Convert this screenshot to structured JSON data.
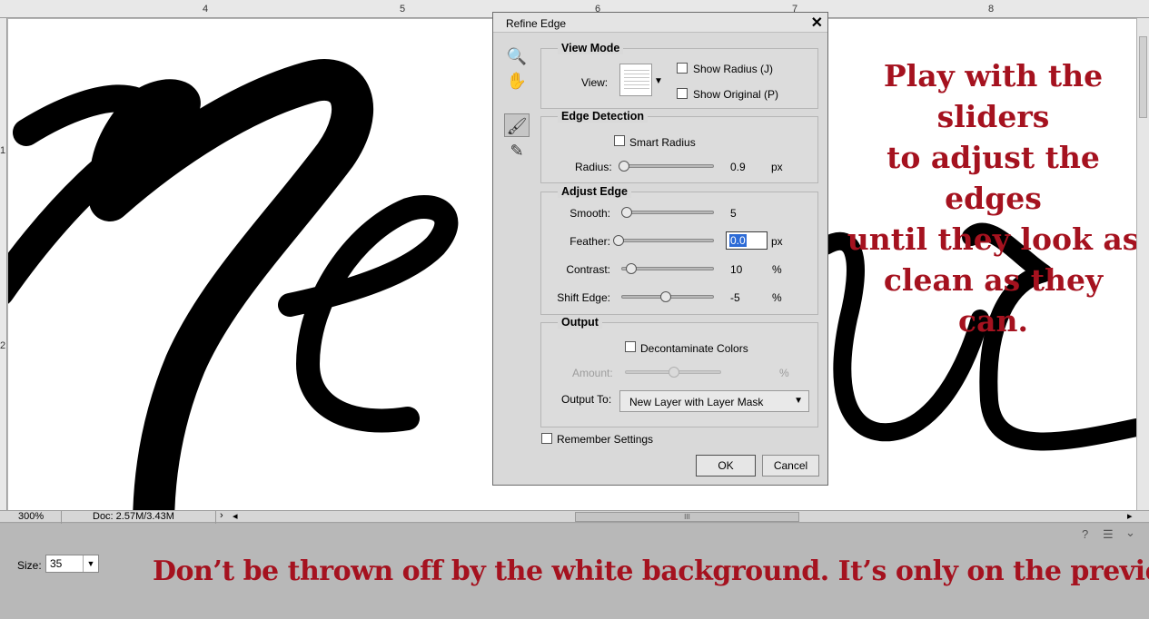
{
  "ruler": {
    "top_numbers": [
      "4",
      "5",
      "6",
      "7",
      "8"
    ],
    "left_numbers": [
      "1",
      "2"
    ]
  },
  "status": {
    "zoom": "300%",
    "doc": "Doc: 2.57M/3.43M",
    "scroll_grip": "III"
  },
  "dialog": {
    "title": "Refine Edge",
    "close_glyph": "✕",
    "tools": {
      "zoom_glyph": "🔍",
      "hand_glyph": "✋",
      "refine_brush_glyph": "🖌",
      "erase_glyph": "✎"
    },
    "view_mode": {
      "title": "View Mode",
      "view_label": "View:",
      "show_radius": "Show Radius (J)",
      "show_original": "Show Original (P)"
    },
    "edge_detection": {
      "title": "Edge Detection",
      "smart_radius": "Smart Radius",
      "radius_label": "Radius:",
      "radius_value": "0.9",
      "radius_unit": "px",
      "radius_level": 0.02
    },
    "adjust_edge": {
      "title": "Adjust Edge",
      "smooth_label": "Smooth:",
      "smooth_value": "5",
      "smooth_level": 0.05,
      "feather_label": "Feather:",
      "feather_value": "0.0",
      "feather_unit": "px",
      "feather_level": 0.0,
      "contrast_label": "Contrast:",
      "contrast_value": "10",
      "contrast_unit": "%",
      "contrast_level": 0.1,
      "shift_label": "Shift Edge:",
      "shift_value": "-5",
      "shift_unit": "%",
      "shift_level": 0.475
    },
    "output": {
      "title": "Output",
      "decontaminate": "Decontaminate Colors",
      "amount_label": "Amount:",
      "amount_unit": "%",
      "output_to_label": "Output To:",
      "output_to_value": "New Layer with Layer Mask"
    },
    "remember": "Remember Settings",
    "ok": "OK",
    "cancel": "Cancel"
  },
  "options": {
    "size_label": "Size:",
    "size_value": "35",
    "help_glyph": "?",
    "menu_glyph": "☰",
    "collapse_glyph": "⌄"
  },
  "captions": {
    "right_lines": [
      "Play with the sliders",
      "to adjust the edges",
      "until they look as",
      "clean as they can."
    ],
    "bottom": "Don’t be thrown off by the white background. It’s only on the preview."
  },
  "colors": {
    "caption": "#a5121f",
    "ink": "#000000",
    "selection": "#2d6bd6"
  }
}
